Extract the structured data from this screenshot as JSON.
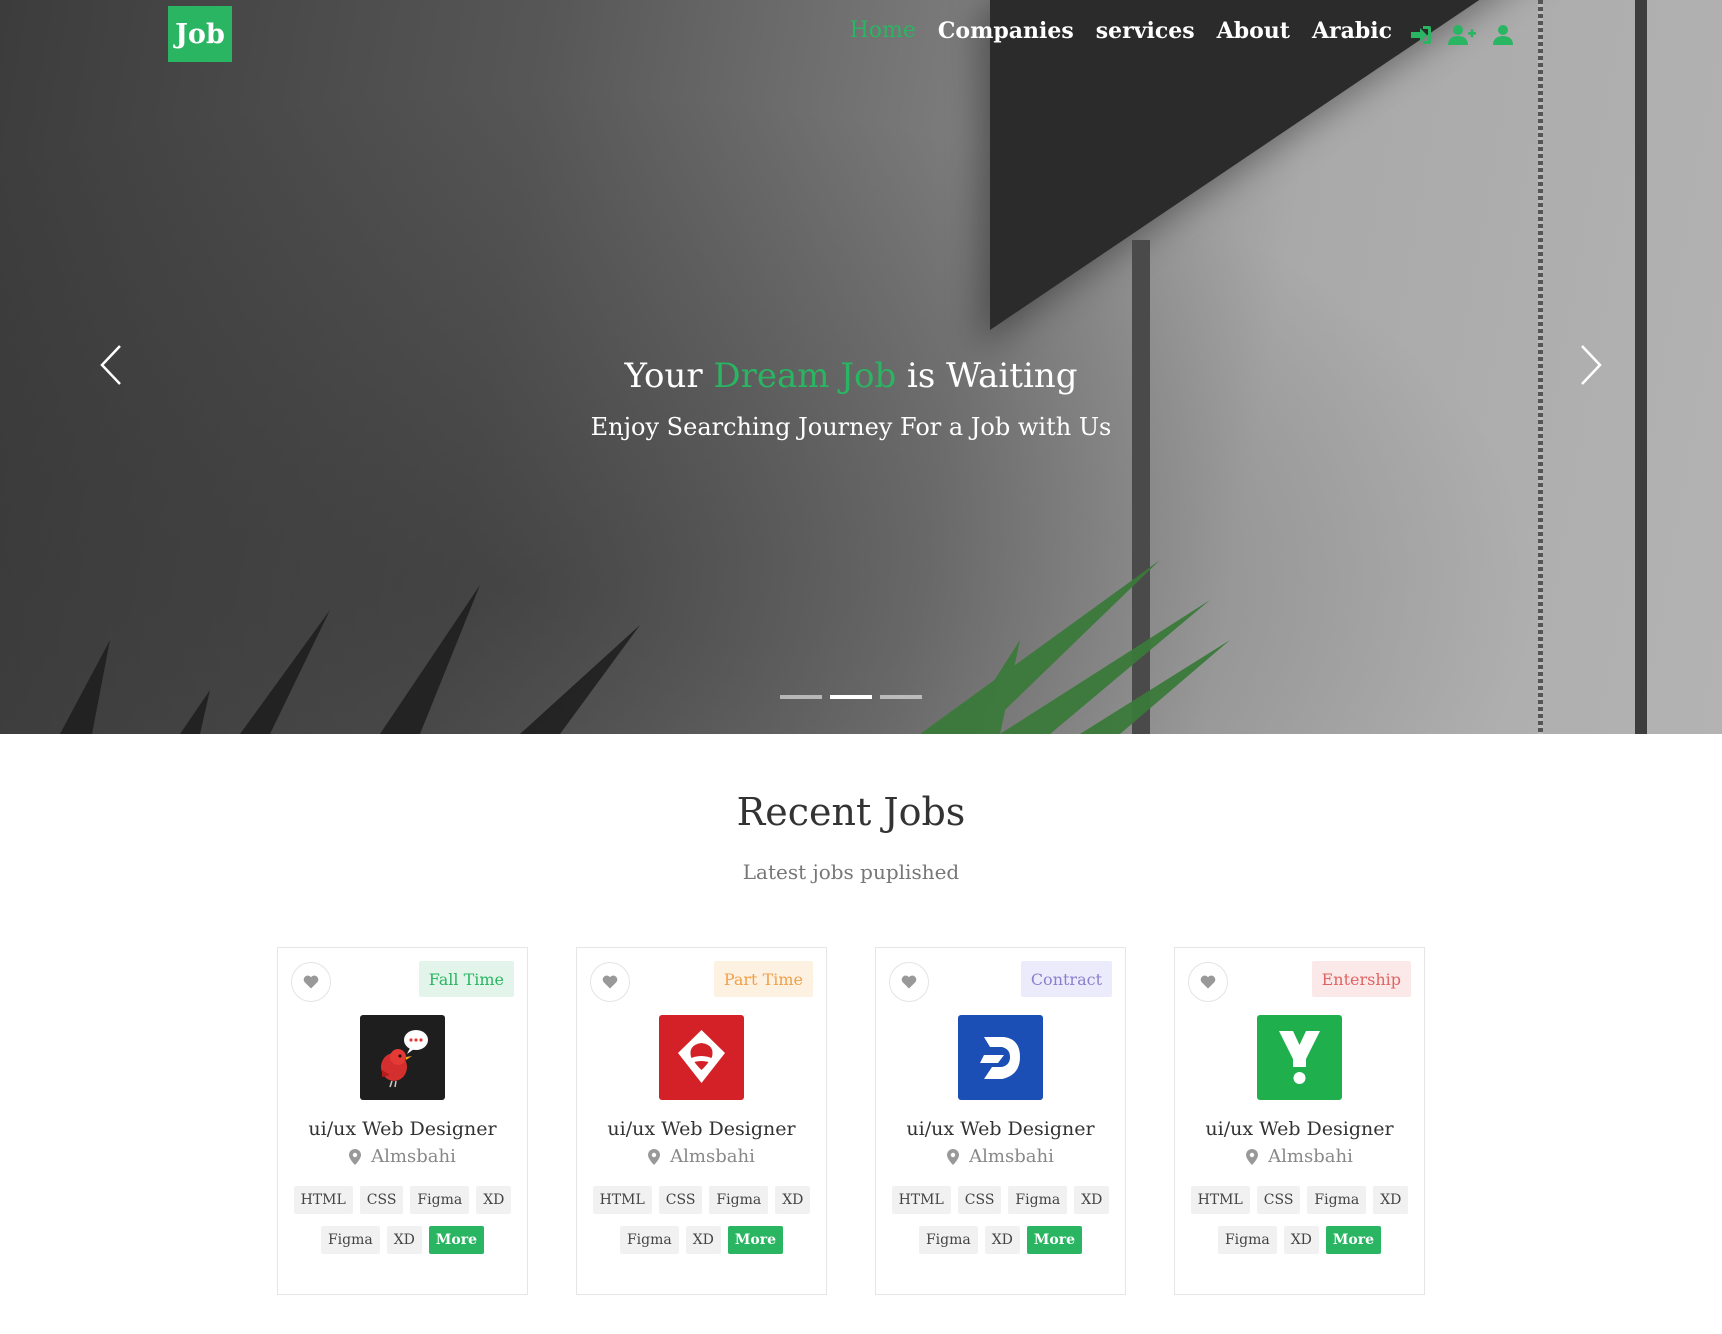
{
  "brand": {
    "logo_text": "Job",
    "accent_color": "#2ab562"
  },
  "nav": {
    "links": [
      {
        "label": "Home",
        "active": true
      },
      {
        "label": "Companies",
        "active": false
      },
      {
        "label": "services",
        "active": false
      },
      {
        "label": "About",
        "active": false
      },
      {
        "label": "Arabic",
        "active": false
      }
    ],
    "icons": [
      "sign-in-icon",
      "user-plus-icon",
      "user-icon"
    ]
  },
  "hero": {
    "title_before": "Your ",
    "title_accent": "Dream Job",
    "title_after": " is Waiting",
    "subtitle": "Enjoy Searching Journey For a Job with Us",
    "slides": 3,
    "active_slide": 2
  },
  "recent_jobs": {
    "title": "Recent Jobs",
    "subtitle": "Latest jobs puplished",
    "jobs": [
      {
        "type": "Fall Time",
        "type_color": "#2ab562",
        "type_bg": "#e3f5ea",
        "logo": "bird-chat-logo",
        "logo_bg": "#1e1e1e",
        "title": "ui/ux Web Designer",
        "location": "Almsbahi",
        "tags_row1": [
          "HTML",
          "CSS",
          "Figma",
          "XD"
        ],
        "tags_row2": [
          "Figma",
          "XD"
        ],
        "more_label": "More"
      },
      {
        "type": "Part Time",
        "type_color": "#f0a04b",
        "type_bg": "#fdf1e2",
        "logo": "red-location-logo",
        "logo_bg": "#d32127",
        "title": "ui/ux Web Designer",
        "location": "Almsbahi",
        "tags_row1": [
          "HTML",
          "CSS",
          "Figma",
          "XD"
        ],
        "tags_row2": [
          "Figma",
          "XD"
        ],
        "more_label": "More"
      },
      {
        "type": "Contract",
        "type_color": "#8b7fcf",
        "type_bg": "#ecebfb",
        "logo": "blue-d-logo",
        "logo_bg": "#1b4fb5",
        "title": "ui/ux Web Designer",
        "location": "Almsbahi",
        "tags_row1": [
          "HTML",
          "CSS",
          "Figma",
          "XD"
        ],
        "tags_row2": [
          "Figma",
          "XD"
        ],
        "more_label": "More"
      },
      {
        "type": "Entership",
        "type_color": "#e06464",
        "type_bg": "#fbe8e8",
        "logo": "green-y-logo",
        "logo_bg": "#1fb04d",
        "title": "ui/ux Web Designer",
        "location": "Almsbahi",
        "tags_row1": [
          "HTML",
          "CSS",
          "Figma",
          "XD"
        ],
        "tags_row2": [
          "Figma",
          "XD"
        ],
        "more_label": "More"
      }
    ]
  }
}
